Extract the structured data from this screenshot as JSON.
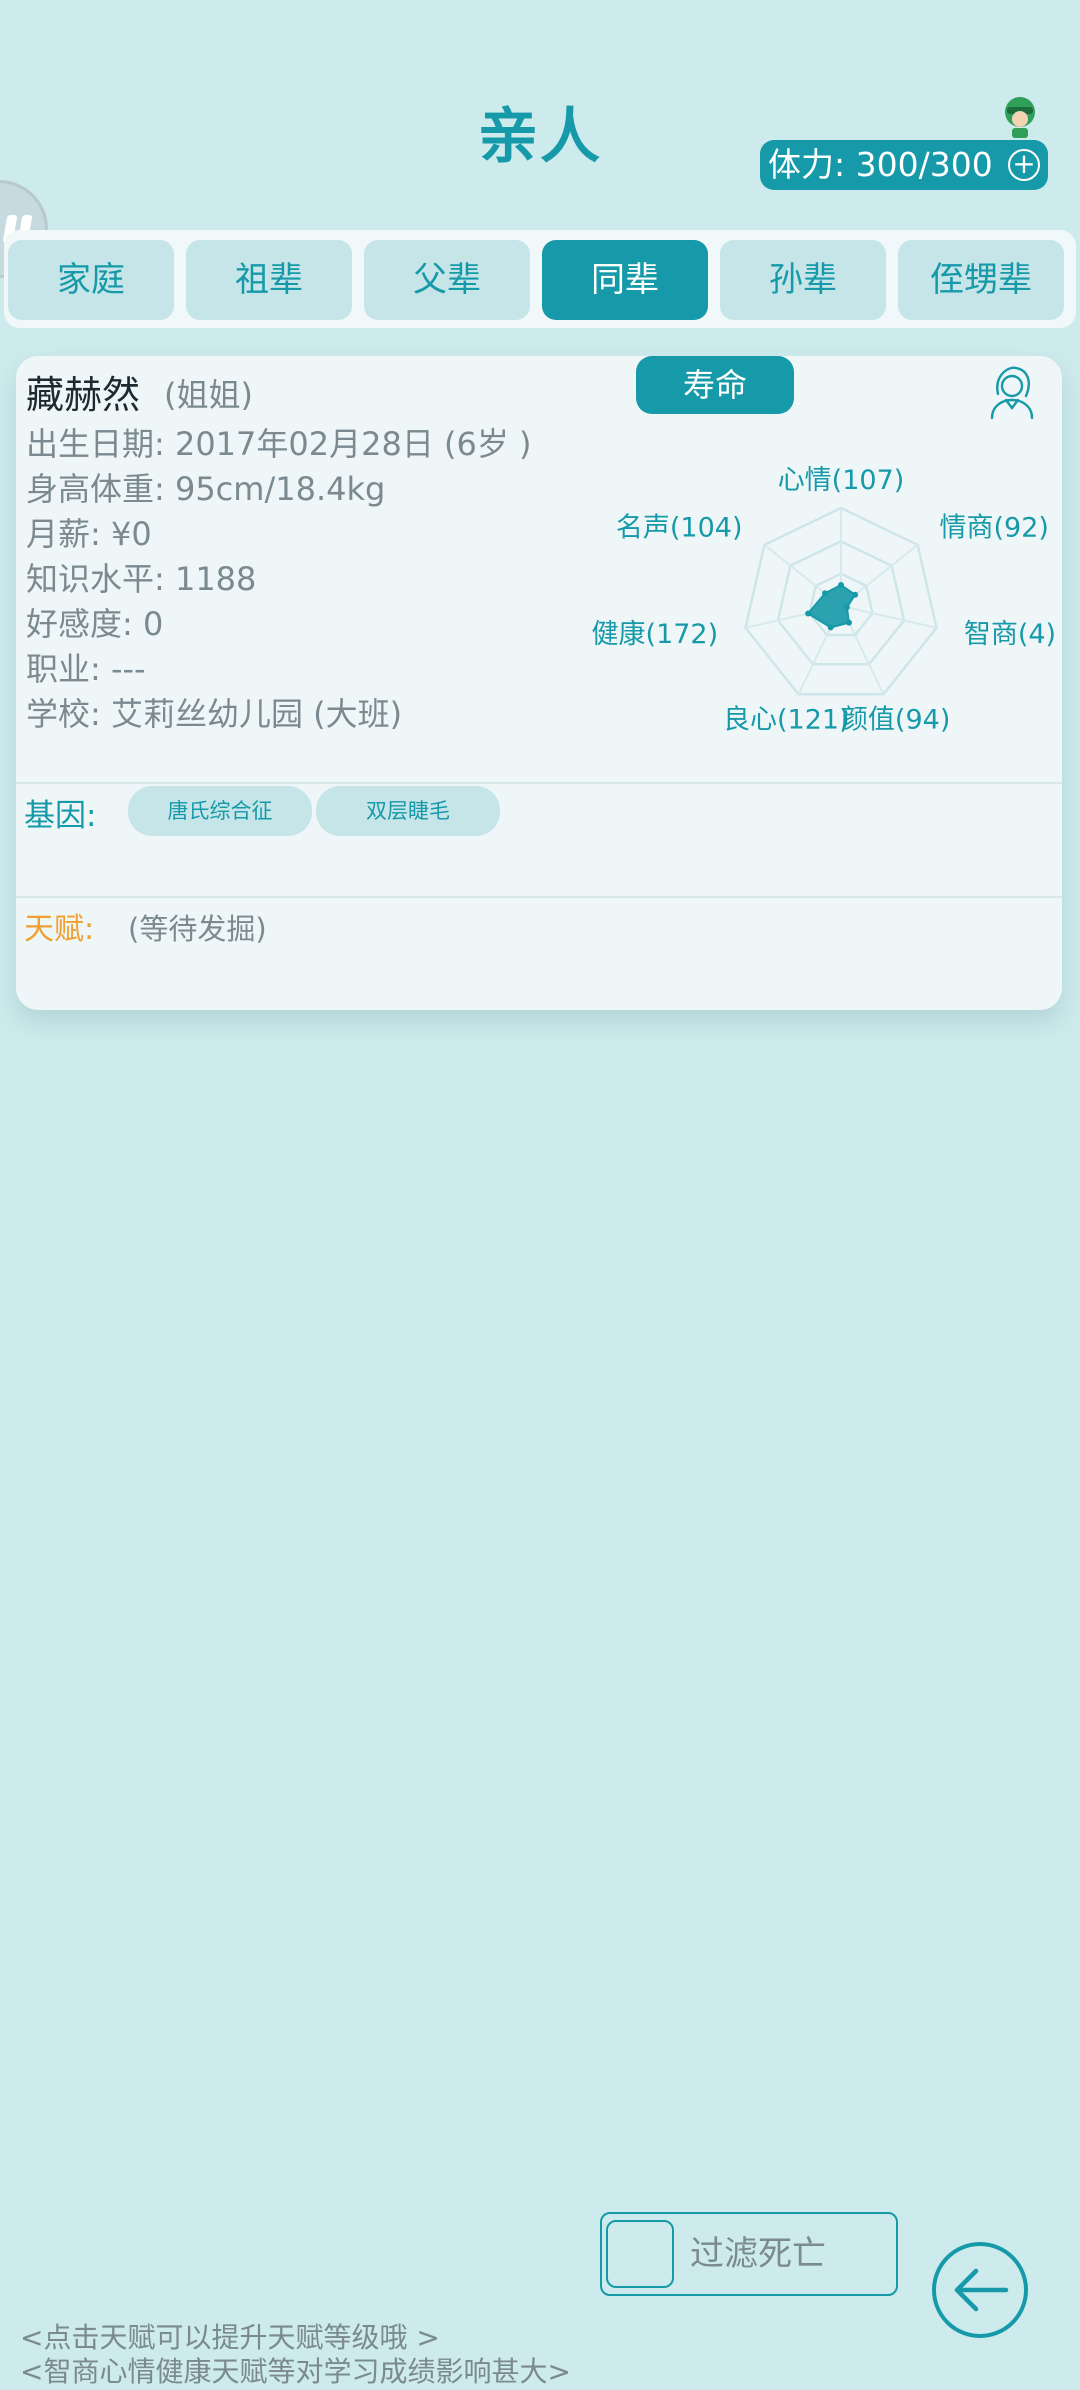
{
  "header": {
    "title": "亲人",
    "stamina": "体力: 300/300"
  },
  "tabs": [
    "家庭",
    "祖辈",
    "父辈",
    "同辈",
    "孙辈",
    "侄甥辈"
  ],
  "active_tab": "同辈",
  "person": {
    "name": "藏赫然",
    "relation": "(姐姐)",
    "lifespan_button": "寿命",
    "info": [
      "出生日期: 2017年02月28日 (6岁 )",
      "身高体重: 95cm/18.4kg",
      "月薪: ¥0",
      "知识水平: 1188",
      "好感度: 0",
      "职业: ---",
      "学校: 艾莉丝幼儿园 (大班)"
    ],
    "genes_label": "基因:",
    "genes": [
      "唐氏综合征",
      "双层睫毛"
    ],
    "talent_label": "天赋:",
    "talent_value": "(等待发掘)"
  },
  "chart_data": {
    "type": "radar",
    "axes": [
      "心情",
      "情商",
      "智商",
      "颜值",
      "良心",
      "健康",
      "名声"
    ],
    "labels": [
      "心情(107)",
      "情商(92)",
      "智商(4)",
      "颜值(94)",
      "良心(121)",
      "健康(172)",
      "名声(104)"
    ],
    "values": [
      107,
      92,
      4,
      94,
      121,
      172,
      104
    ],
    "max": 500,
    "color": "#1699a8"
  },
  "footer": {
    "filter_label": "过滤死亡",
    "hint1": "<点击天赋可以提升天赋等级哦 >",
    "hint2": "<智商心情健康天赋等对学习成绩影响甚大>"
  },
  "colors": {
    "accent": "#1699a8",
    "background": "#cdeaec",
    "talent": "#f0a030"
  }
}
